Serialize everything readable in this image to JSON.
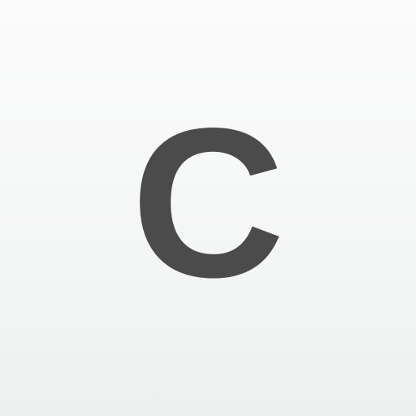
{
  "icon": {
    "letter": "C",
    "glyph_color": "#4b4b4b",
    "background_top": "#fbfbfb",
    "background_bottom": "#eef0f0"
  }
}
